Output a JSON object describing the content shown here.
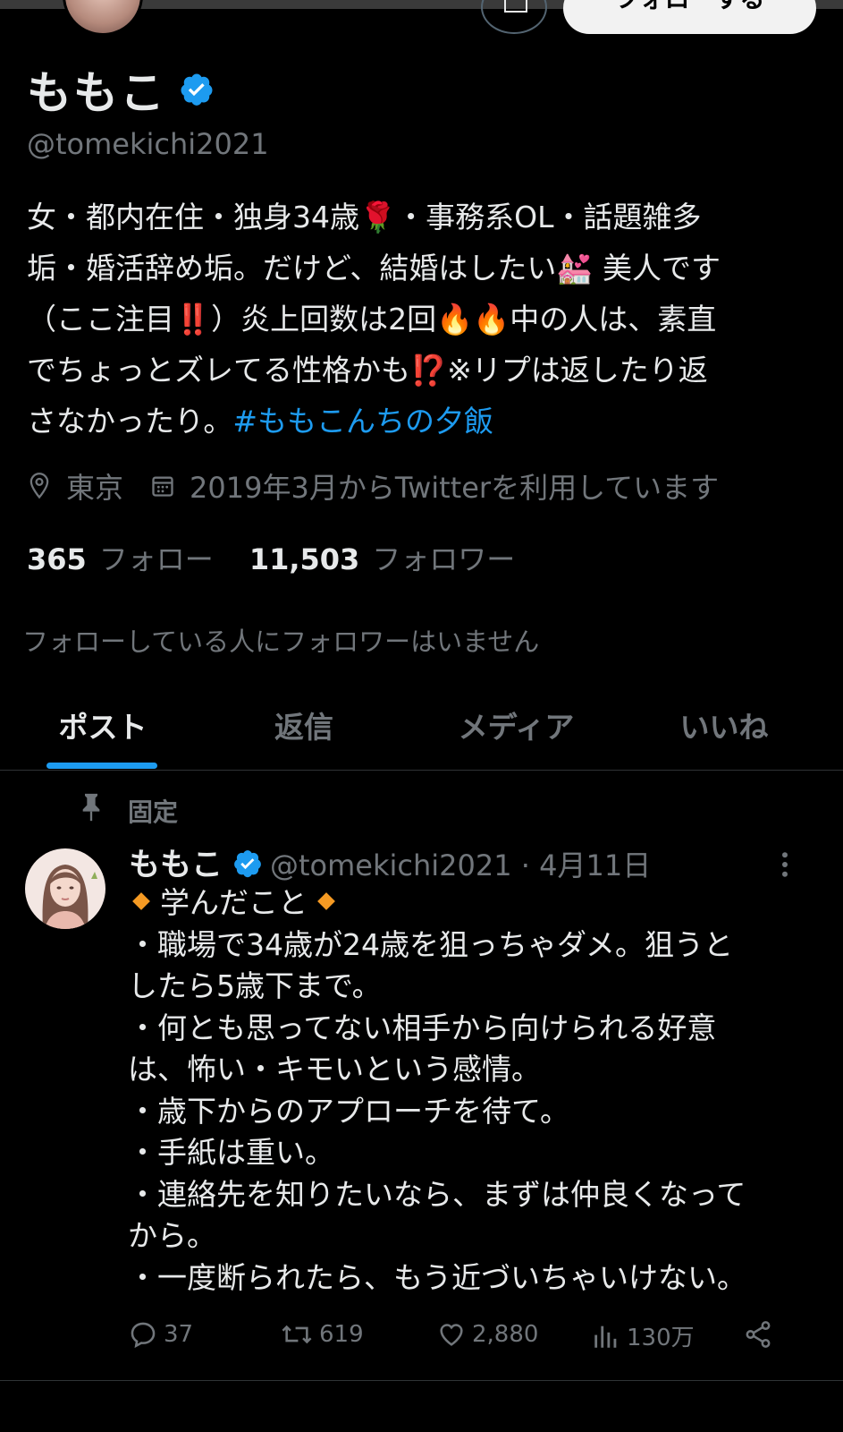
{
  "top_bar": {
    "follow_button_label": "フォローする"
  },
  "profile": {
    "display_name": "ももこ",
    "handle": "@tomekichi2021",
    "bio_parts": {
      "l1": "女・都内在住・独身34歳",
      "e_rose": "🌹",
      "l1b": "・事務系OL・話題雑多",
      "l2": "垢・婚活辞め垢。だけど、結婚はしたい",
      "e_chapel": "💒",
      "l2b": " 美人です",
      "l3": "（ここ注目",
      "e_bang": "‼️",
      "l3b": "）炎上回数は2回",
      "e_fire": "🔥🔥",
      "l3c": "中の人は、素直",
      "l4": "でちょっとズレてる性格かも",
      "e_q": "⁉️",
      "l4b": "※リプは返したり返",
      "l5": "さなかったり。",
      "hashtag": "#ももこんちの夕飯"
    },
    "location": "東京",
    "joined": "2019年3月からTwitterを利用しています",
    "following_count": "365",
    "following_label": "フォロー",
    "followers_count": "11,503",
    "followers_label": "フォロワー",
    "known_followers_text": "フォローしている人にフォロワーはいません"
  },
  "tabs": [
    {
      "label": "ポスト",
      "active": true
    },
    {
      "label": "返信",
      "active": false
    },
    {
      "label": "メディア",
      "active": false
    },
    {
      "label": "いいね",
      "active": false
    }
  ],
  "pinned_post": {
    "pinned_label": "固定",
    "author_name": "ももこ",
    "author_handle": "@tomekichi2021",
    "date": "4月11日",
    "heading": "学んだこと",
    "lines": [
      "・職場で34歳が24歳を狙っちゃダメ。狙うと",
      "したら5歳下まで。",
      "・何とも思ってない相手から向けられる好意",
      "は、怖い・キモいという感情。",
      "・歳下からのアプローチを待て。",
      "・手紙は重い。",
      "・連絡先を知りたいなら、まずは仲良くなって",
      "から。",
      "・一度断られたら、もう近づいちゃいけない。"
    ],
    "replies": "37",
    "reposts": "619",
    "likes": "2,880",
    "views": "130万"
  },
  "colors": {
    "accent": "#1d9bf0",
    "background": "#000000",
    "text_primary": "#e7e9ea",
    "text_secondary": "#71767b",
    "divider": "#2f3336"
  }
}
